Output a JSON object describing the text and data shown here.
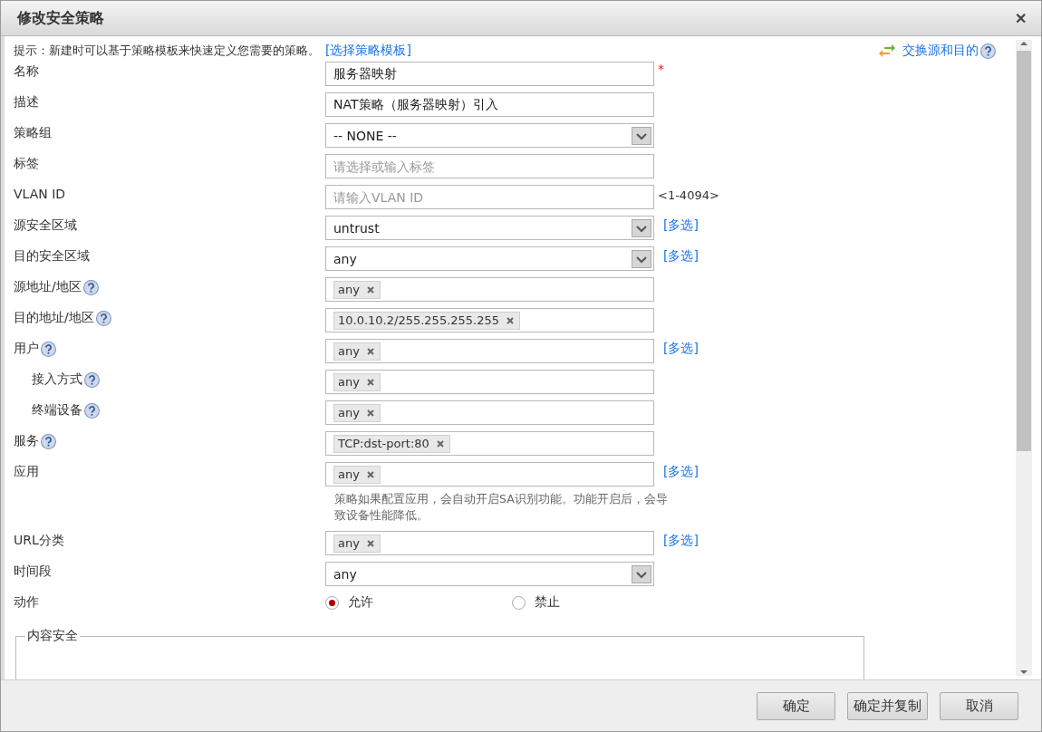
{
  "window": {
    "title": "修改安全策略",
    "close": "✕"
  },
  "hint": {
    "text": "提示：新建时可以基于策略模板来快速定义您需要的策略。",
    "link": "[选择策略模板]"
  },
  "swap_link": "交换源和目的",
  "fields": [
    {
      "kind": "text",
      "label": "名称",
      "value": "服务器映射",
      "required": "*"
    },
    {
      "kind": "text",
      "label": "描述",
      "value": "NAT策略（服务器映射）引入"
    },
    {
      "kind": "select",
      "label": "策略组",
      "value": "-- NONE --"
    },
    {
      "kind": "text",
      "label": "标签",
      "placeholder": "请选择或输入标签"
    },
    {
      "kind": "text",
      "label": "VLAN ID",
      "placeholder": "请输入VLAN ID",
      "suffix": "<1-4094>"
    },
    {
      "kind": "select",
      "label": "源安全区域",
      "value": "untrust",
      "link": "[多选]"
    },
    {
      "kind": "select",
      "label": "目的安全区域",
      "value": "any",
      "link": "[多选]"
    },
    {
      "kind": "tags",
      "label": "源地址/地区",
      "help": true,
      "tags": [
        "any"
      ]
    },
    {
      "kind": "tags",
      "label": "目的地址/地区",
      "help": true,
      "tags": [
        "10.0.10.2/255.255.255.255"
      ]
    },
    {
      "kind": "tags",
      "label": "用户",
      "help": true,
      "tags": [
        "any"
      ],
      "link": "[多选]",
      "children": [
        {
          "kind": "tags",
          "label": "接入方式",
          "help": true,
          "tags": [
            "any"
          ]
        },
        {
          "kind": "tags",
          "label": "终端设备",
          "help": true,
          "tags": [
            "any"
          ]
        }
      ]
    },
    {
      "kind": "tags",
      "label": "服务",
      "help": true,
      "tags": [
        "TCP:dst-port:80"
      ]
    },
    {
      "kind": "tags",
      "label": "应用",
      "tags": [
        "any"
      ],
      "link": "[多选]",
      "note": "策略如果配置应用，会自动开启SA识别功能。功能开启后，会导致设备性能降低。"
    },
    {
      "kind": "tags",
      "label": "URL分类",
      "tags": [
        "any"
      ],
      "link": "[多选]"
    },
    {
      "kind": "select",
      "label": "时间段",
      "value": "any"
    },
    {
      "kind": "radio",
      "label": "动作",
      "options": [
        {
          "label": "允许",
          "selected": true
        },
        {
          "label": "禁止",
          "selected": false
        }
      ]
    }
  ],
  "section": {
    "legend": "内容安全"
  },
  "buttons": [
    "确定",
    "确定并复制",
    "取消"
  ]
}
